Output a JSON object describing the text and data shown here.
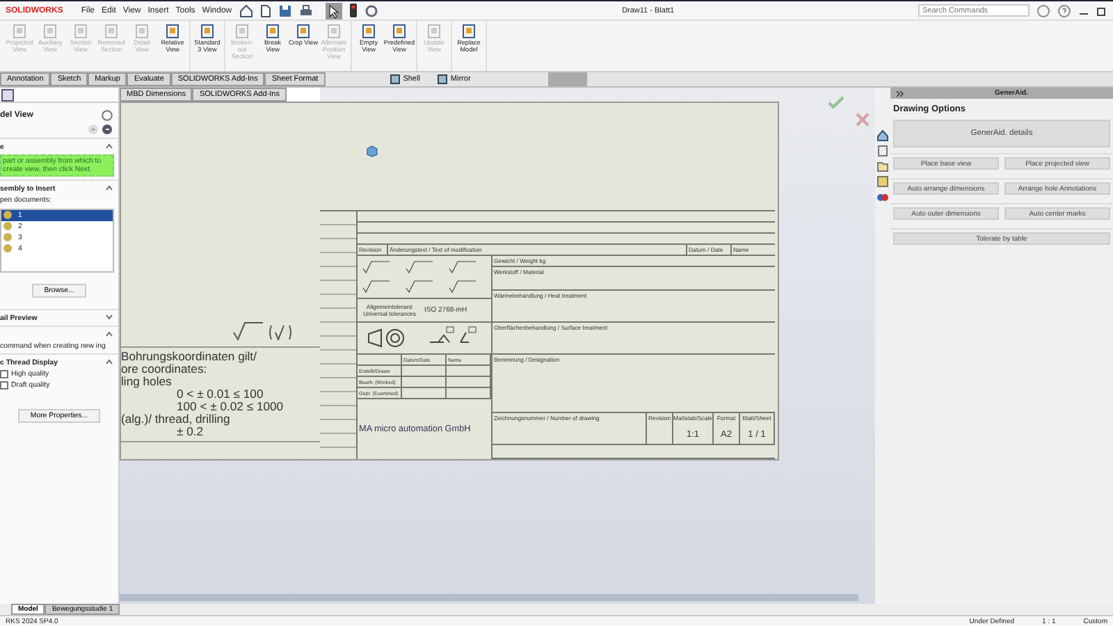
{
  "app": {
    "logo": "SOLIDWORKS",
    "menu": [
      "File",
      "Edit",
      "View",
      "Insert",
      "Tools",
      "Window"
    ],
    "title": "Draw11 - Blatt1",
    "search": {
      "placeholder": "Search Commands"
    }
  },
  "ribbon": [
    [
      {
        "label": "Projected View",
        "disabled": true
      },
      {
        "label": "Auxiliary View",
        "disabled": true
      },
      {
        "label": "Section View",
        "disabled": true
      },
      {
        "label": "Removed Section",
        "disabled": true
      },
      {
        "label": "Detail View",
        "disabled": true
      },
      {
        "label": "Relative View",
        "disabled": false
      }
    ],
    [
      {
        "label": "Standard 3 View",
        "disabled": false
      }
    ],
    [
      {
        "label": "Broken-out Section",
        "disabled": true
      },
      {
        "label": "Break View",
        "disabled": false
      },
      {
        "label": "Crop View",
        "disabled": false
      },
      {
        "label": "Alternate Position View",
        "disabled": true
      }
    ],
    [
      {
        "label": "Empty View",
        "disabled": false
      },
      {
        "label": "Predefined View",
        "disabled": false
      }
    ],
    [
      {
        "label": "Update View",
        "disabled": true
      }
    ],
    [
      {
        "label": "Replace Model",
        "disabled": false
      }
    ]
  ],
  "command_tabs": [
    {
      "label": "Annotation",
      "selected": false
    },
    {
      "label": "Sketch",
      "selected": false
    },
    {
      "label": "Markup",
      "selected": false
    },
    {
      "label": "Evaluate",
      "selected": false
    },
    {
      "label": "SOLIDWORKS Add-Ins",
      "selected": false
    },
    {
      "label": "Sheet Format",
      "selected": false
    }
  ],
  "tools": [
    "Shell",
    "Mirror"
  ],
  "sub_tabs": [
    "MBD Dimensions",
    "SOLIDWORKS Add-Ins"
  ],
  "property_manager": {
    "title": "del View",
    "message_header": "e",
    "message": "part or assembly from which to create view, then click Next.",
    "insert_header": "sembly to Insert",
    "open_label": "pen documents:",
    "documents": [
      {
        "label": "1",
        "selected": true
      },
      {
        "label": "2",
        "selected": false
      },
      {
        "label": "3",
        "selected": false
      },
      {
        "label": "4",
        "selected": false
      }
    ],
    "browse": "Browse...",
    "preview_header": "ail Preview",
    "option_text": "command when creating new ing",
    "thread_header": "c Thread Display",
    "thread_options": [
      {
        "label": "High quality",
        "checked": false
      },
      {
        "label": "Draft quality",
        "checked": false
      }
    ],
    "more": "More Properties..."
  },
  "sheet": {
    "note": [
      "Bohrungskoordinaten gilt/",
      "ore coordinates:",
      "ling holes",
      "0 < ± 0.01 ≤ 100",
      "100 < ± 0.02 ≤ 1000",
      "(alg.)/ thread, drilling",
      "± 0.2"
    ],
    "title_block": {
      "revision": "Revision",
      "modification": "Änderungstext / Text of modification",
      "date": "Datum / Date",
      "name": "Name",
      "tolerance": "Allgemeintoleranz Universal tolerances",
      "tolerance_std": "ISO 2768-mH",
      "table_head": [
        "Datum/Date",
        "Name"
      ],
      "roles": [
        "Erstellt/Drawn",
        "Bearb. (Worked)",
        "Gepr. (Examined)"
      ],
      "company": "MA micro automation GmbH",
      "fields": [
        "Gewicht / Weight kg",
        "Werkstoff / Material",
        "Wärmebehandlung / Heat treatment",
        "Oberflächenbehandlung / Surface treatment",
        "Benennung / Designation"
      ],
      "drawing_number": "Zeichnungsnummer / Number of drawing",
      "rev": "Revision",
      "scale_label": "Maßstab/Scale",
      "scale": "1:1",
      "format_label": "Format",
      "format": "A2",
      "sheet_label": "Blatt/Sheet",
      "sheet": "1 / 1"
    }
  },
  "taskpane": {
    "header": "GenerAid.",
    "section": "Drawing Options",
    "main_button": "GenerAid. details",
    "buttons": [
      [
        "Place base view",
        "Place projected view"
      ],
      [
        "Auto arrange dimensions",
        "Arrange hole Annotations"
      ],
      [
        "Auto outer dimensions",
        "Auto center marks"
      ],
      [
        "Tolerate by table"
      ]
    ]
  },
  "bottom_tabs": [
    {
      "label": "Model",
      "selected": true
    },
    {
      "label": "Bewegungsstudie 1",
      "selected": false
    }
  ],
  "status_bar": {
    "version": "RKS 2024 SP4.0",
    "state": "Under Defined",
    "scale": "1 : 1",
    "units": "Custom"
  }
}
